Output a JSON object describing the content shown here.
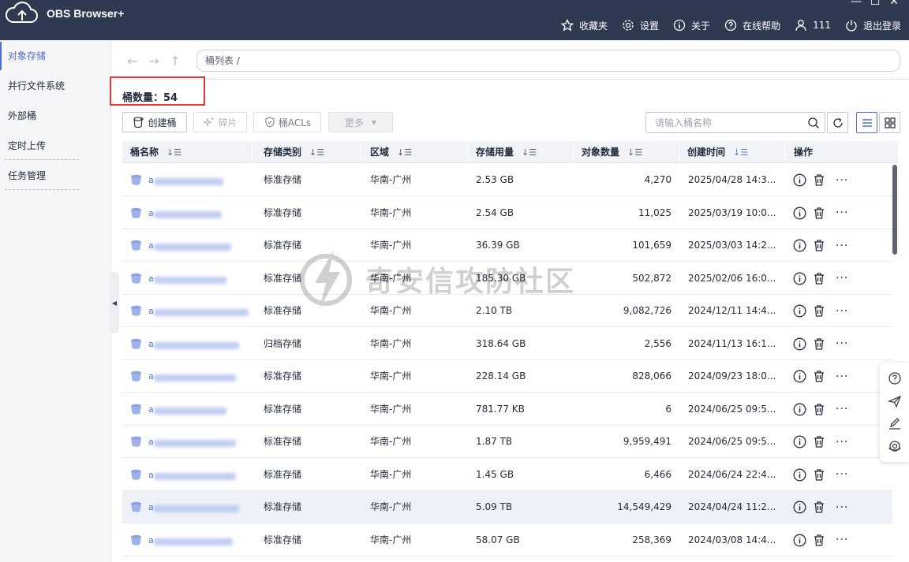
{
  "app": {
    "title": "OBS Browser+"
  },
  "window_controls": [
    "—",
    "☐",
    "✕"
  ],
  "header_nav": [
    {
      "icon": "star-icon",
      "label": "收藏夹"
    },
    {
      "icon": "gear-icon",
      "label": "设置"
    },
    {
      "icon": "info-icon",
      "label": "关于"
    },
    {
      "icon": "help-icon",
      "label": "在线帮助"
    },
    {
      "icon": "user-icon",
      "label": "111"
    },
    {
      "icon": "power-icon",
      "label": "退出登录"
    }
  ],
  "sidebar": {
    "items": [
      {
        "label": "对象存储",
        "active": true
      },
      {
        "label": "并行文件系统",
        "active": false
      },
      {
        "label": "外部桶",
        "active": false
      },
      {
        "label": "定时上传",
        "active": false
      },
      {
        "label": "任务管理",
        "active": false
      }
    ]
  },
  "breadcrumb": "桶列表 /",
  "bucket_count": "桶数量：54",
  "toolbar": {
    "create": "创建桶",
    "fragments": "碎片",
    "acls": "桶ACLs",
    "more": "更多",
    "search_placeholder": "请输入桶名称"
  },
  "table": {
    "columns": [
      "桶名称",
      "存储类别",
      "区域",
      "存储用量",
      "对象数量",
      "创建时间",
      "操作"
    ],
    "rows": [
      {
        "name": "a",
        "class": "标准存储",
        "region": "华南-广州",
        "usage": "2.53 GB",
        "objects": "4,270",
        "created": "2025/04/28 14:3..."
      },
      {
        "name": "a",
        "class": "标准存储",
        "region": "华南-广州",
        "usage": "2.54 GB",
        "objects": "11,025",
        "created": "2025/03/19 10:0..."
      },
      {
        "name": "a",
        "class": "标准存储",
        "region": "华南-广州",
        "usage": "36.39 GB",
        "objects": "101,659",
        "created": "2025/03/03 14:2..."
      },
      {
        "name": "a",
        "class": "标准存储",
        "region": "华南-广州",
        "usage": "185.30 GB",
        "objects": "502,872",
        "created": "2025/02/06 16:0..."
      },
      {
        "name": "a",
        "class": "标准存储",
        "region": "华南-广州",
        "usage": "2.10 TB",
        "objects": "9,082,726",
        "created": "2024/12/11 14:4..."
      },
      {
        "name": "a",
        "class": "归档存储",
        "region": "华南-广州",
        "usage": "318.64 GB",
        "objects": "2,556",
        "created": "2024/11/13 16:1..."
      },
      {
        "name": "a",
        "class": "标准存储",
        "region": "华南-广州",
        "usage": "228.14 GB",
        "objects": "828,066",
        "created": "2024/09/23 18:0..."
      },
      {
        "name": "a",
        "class": "标准存储",
        "region": "华南-广州",
        "usage": "781.77 KB",
        "objects": "6",
        "created": "2024/06/25 09:5..."
      },
      {
        "name": "a",
        "class": "标准存储",
        "region": "华南-广州",
        "usage": "1.87 TB",
        "objects": "9,959,491",
        "created": "2024/06/25 09:5..."
      },
      {
        "name": "a",
        "class": "标准存储",
        "region": "华南-广州",
        "usage": "1.45 GB",
        "objects": "6,466",
        "created": "2024/06/24 22:4..."
      },
      {
        "name": "a",
        "class": "标准存储",
        "region": "华南-广州",
        "usage": "5.09 TB",
        "objects": "14,549,429",
        "created": "2024/04/24 11:2..."
      },
      {
        "name": "a",
        "class": "标准存储",
        "region": "华南-广州",
        "usage": "58.07 GB",
        "objects": "258,369",
        "created": "2024/03/08 14:4..."
      }
    ]
  },
  "watermark": "奇安信攻防社区",
  "colors": {
    "header_bg": "#2f3a52",
    "accent": "#526ecc",
    "alert_box": "#e53935"
  }
}
